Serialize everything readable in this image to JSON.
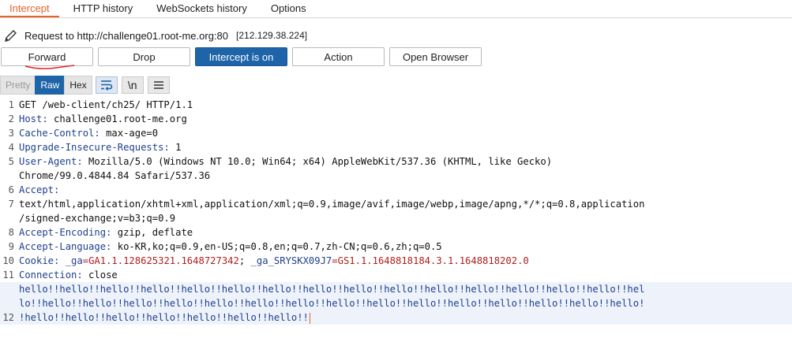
{
  "tabs": [
    {
      "label": "Intercept"
    },
    {
      "label": "HTTP history"
    },
    {
      "label": "WebSockets history"
    },
    {
      "label": "Options"
    }
  ],
  "request": {
    "prefix": "Request to ",
    "url": "http://challenge01.root-me.org:80",
    "ip": "[212.129.38.224]"
  },
  "toolbar": {
    "forward": "Forward",
    "drop": "Drop",
    "intercept": "Intercept is on",
    "action": "Action",
    "open_browser": "Open Browser"
  },
  "view": {
    "pretty": "Pretty",
    "raw": "Raw",
    "hex": "Hex",
    "newline_toggle": "\\n",
    "menu_icon": "menu-icon",
    "wrap_icon": "wrap-icon"
  },
  "editor": {
    "line_numbers": [
      "1",
      "2",
      "3",
      "4",
      "5",
      "",
      "6",
      "7",
      "",
      "8",
      "9",
      "10",
      "11",
      "",
      "",
      "12",
      ""
    ],
    "lines": [
      {
        "plain": "GET /web-client/ch25/ HTTP/1.1"
      },
      {
        "key": "Host:",
        "val": " challenge01.root-me.org"
      },
      {
        "key": "Cache-Control:",
        "val": " max-age=0"
      },
      {
        "key": "Upgrade-Insecure-Requests:",
        "val": " 1"
      },
      {
        "key": "User-Agent:",
        "val": " Mozilla/5.0 (Windows NT 10.0; Win64; x64) AppleWebKit/537.36 (KHTML, like Gecko)"
      },
      {
        "plain": "Chrome/99.0.4844.84 Safari/537.36"
      },
      {
        "key": "Accept:",
        "val": ""
      },
      {
        "plain": "text/html,application/xhtml+xml,application/xml;q=0.9,image/avif,image/webp,image/apng,*/*;q=0.8,application"
      },
      {
        "plain": "/signed-exchange;v=b3;q=0.9"
      },
      {
        "key": "Accept-Encoding:",
        "val": " gzip, deflate"
      },
      {
        "key": "Accept-Language:",
        "val": " ko-KR,ko;q=0.9,en-US;q=0.8,en;q=0.7,zh-CN;q=0.6,zh;q=0.5"
      },
      {
        "cookie": true,
        "key": "Cookie:",
        "c1k": " _ga",
        "c1v": "=GA1.1.128625321.1648727342",
        "sep": ";",
        "c2k": " _ga_SRYSKX09J7",
        "c2v": "=GS1.1.1648818184.3.1.1648818202.0"
      },
      {
        "key": "Connection:",
        "val": " close"
      },
      {
        "body": "hello!!hello!!hello!!hello!!hello!!hello!!hello!!hello!!hello!!hello!!hello!!hello!!hello!!hello!!hello!!hel"
      },
      {
        "body": "lo!!hello!!hello!!hello!!hello!!hello!!hello!!hello!!hello!!hello!!hello!!hello!!hello!!hello!!hello!!hello!"
      },
      {
        "body": "!hello!!hello!!hello!!hello!!hello!!hello!!hello!!",
        "caret": true
      },
      {
        "plain": ""
      },
      {
        "plain": ""
      }
    ]
  }
}
